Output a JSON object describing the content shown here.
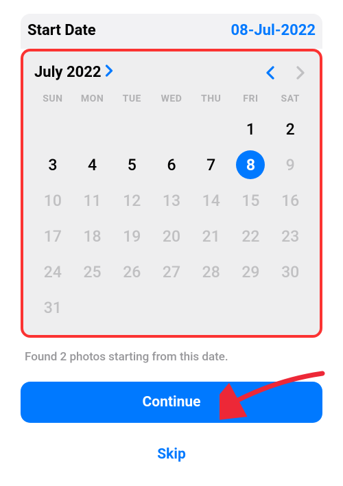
{
  "header": {
    "title": "Start Date",
    "selected_date": "08-Jul-2022"
  },
  "calendar": {
    "month_label": "July 2022",
    "weekdays": [
      "SUN",
      "MON",
      "TUE",
      "WED",
      "THU",
      "FRI",
      "SAT"
    ],
    "days": [
      {
        "n": "",
        "state": "empty"
      },
      {
        "n": "",
        "state": "empty"
      },
      {
        "n": "",
        "state": "empty"
      },
      {
        "n": "",
        "state": "empty"
      },
      {
        "n": "",
        "state": "empty"
      },
      {
        "n": "1",
        "state": "active"
      },
      {
        "n": "2",
        "state": "active"
      },
      {
        "n": "3",
        "state": "active"
      },
      {
        "n": "4",
        "state": "active"
      },
      {
        "n": "5",
        "state": "active"
      },
      {
        "n": "6",
        "state": "active"
      },
      {
        "n": "7",
        "state": "active"
      },
      {
        "n": "8",
        "state": "selected"
      },
      {
        "n": "9",
        "state": "inactive"
      },
      {
        "n": "10",
        "state": "inactive"
      },
      {
        "n": "11",
        "state": "inactive"
      },
      {
        "n": "12",
        "state": "inactive"
      },
      {
        "n": "13",
        "state": "inactive"
      },
      {
        "n": "14",
        "state": "inactive"
      },
      {
        "n": "15",
        "state": "inactive"
      },
      {
        "n": "16",
        "state": "inactive"
      },
      {
        "n": "17",
        "state": "inactive"
      },
      {
        "n": "18",
        "state": "inactive"
      },
      {
        "n": "19",
        "state": "inactive"
      },
      {
        "n": "20",
        "state": "inactive"
      },
      {
        "n": "21",
        "state": "inactive"
      },
      {
        "n": "22",
        "state": "inactive"
      },
      {
        "n": "23",
        "state": "inactive"
      },
      {
        "n": "24",
        "state": "inactive"
      },
      {
        "n": "25",
        "state": "inactive"
      },
      {
        "n": "26",
        "state": "inactive"
      },
      {
        "n": "27",
        "state": "inactive"
      },
      {
        "n": "28",
        "state": "inactive"
      },
      {
        "n": "29",
        "state": "inactive"
      },
      {
        "n": "30",
        "state": "inactive"
      },
      {
        "n": "31",
        "state": "inactive"
      }
    ]
  },
  "status_text": "Found 2 photos starting from this date.",
  "continue_label": "Continue",
  "skip_label": "Skip",
  "colors": {
    "accent": "#0079ff",
    "highlight_border": "#fb3332",
    "arrow": "#ed2837"
  }
}
